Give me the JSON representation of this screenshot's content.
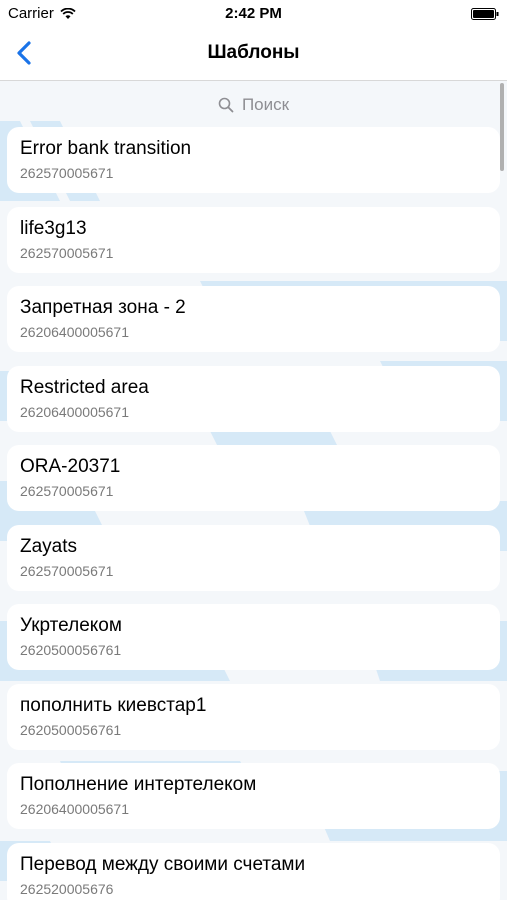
{
  "status_bar": {
    "carrier": "Carrier",
    "time": "2:42 PM"
  },
  "nav": {
    "title": "Шаблоны"
  },
  "search": {
    "placeholder": "Поиск"
  },
  "templates": [
    {
      "title": "Error bank transition",
      "account": "262570005671"
    },
    {
      "title": "life3g13",
      "account": "262570005671"
    },
    {
      "title": "Запретная зона - 2",
      "account": "26206400005671"
    },
    {
      "title": "Restricted area",
      "account": "26206400005671"
    },
    {
      "title": "ORA-20371",
      "account": "262570005671"
    },
    {
      "title": "Zayats",
      "account": "262570005671"
    },
    {
      "title": "Укртелеком",
      "account": "2620500056761"
    },
    {
      "title": "пополнить киевстар1",
      "account": "2620500056761"
    },
    {
      "title": "Пополнение интертелеком",
      "account": "26206400005671"
    },
    {
      "title": "Перевод между своими счетами",
      "account": "262520005676"
    }
  ],
  "colors": {
    "accent": "#1a73e8",
    "background_pattern": "#d6e9f7"
  }
}
